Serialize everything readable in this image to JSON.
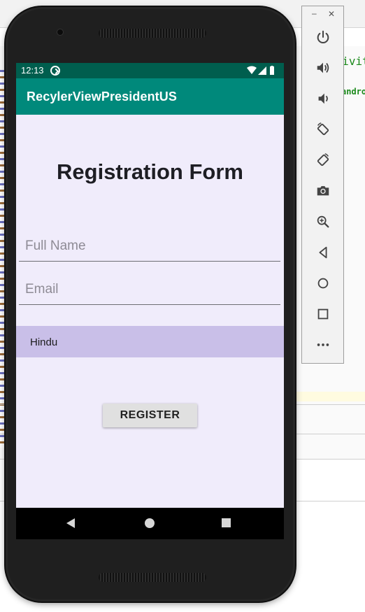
{
  "emulator": {
    "status_bar": {
      "time": "12:13"
    },
    "app_bar": {
      "title": "RecylerViewPresidentUS"
    },
    "form": {
      "heading": "Registration Form",
      "full_name": {
        "placeholder": "Full Name",
        "value": ""
      },
      "email": {
        "placeholder": "Email",
        "value": ""
      },
      "religion_spinner": {
        "selected": "Hindu"
      },
      "register_label": "REGISTER"
    },
    "nav_bar": {
      "items": [
        "back-icon",
        "home-icon",
        "recents-icon"
      ]
    }
  },
  "emulator_toolbar": {
    "minimize_label": "–",
    "close_label": "✕",
    "buttons": [
      "power-icon",
      "volume-up-icon",
      "volume-down-icon",
      "rotate-left-icon",
      "rotate-right-icon",
      "camera-icon",
      "zoom-icon",
      "back-icon",
      "home-icon",
      "overview-icon",
      "more-icon"
    ]
  },
  "ide_background": {
    "code_snippet_1": "ctivit",
    "code_snippet_2": "andro"
  },
  "colors": {
    "status_bar": "#005e4e",
    "app_bar": "#00897b",
    "screen_bg": "#f0ecfb",
    "spinner_bg": "#c9bfe8",
    "button_bg": "#e0e0e0"
  }
}
